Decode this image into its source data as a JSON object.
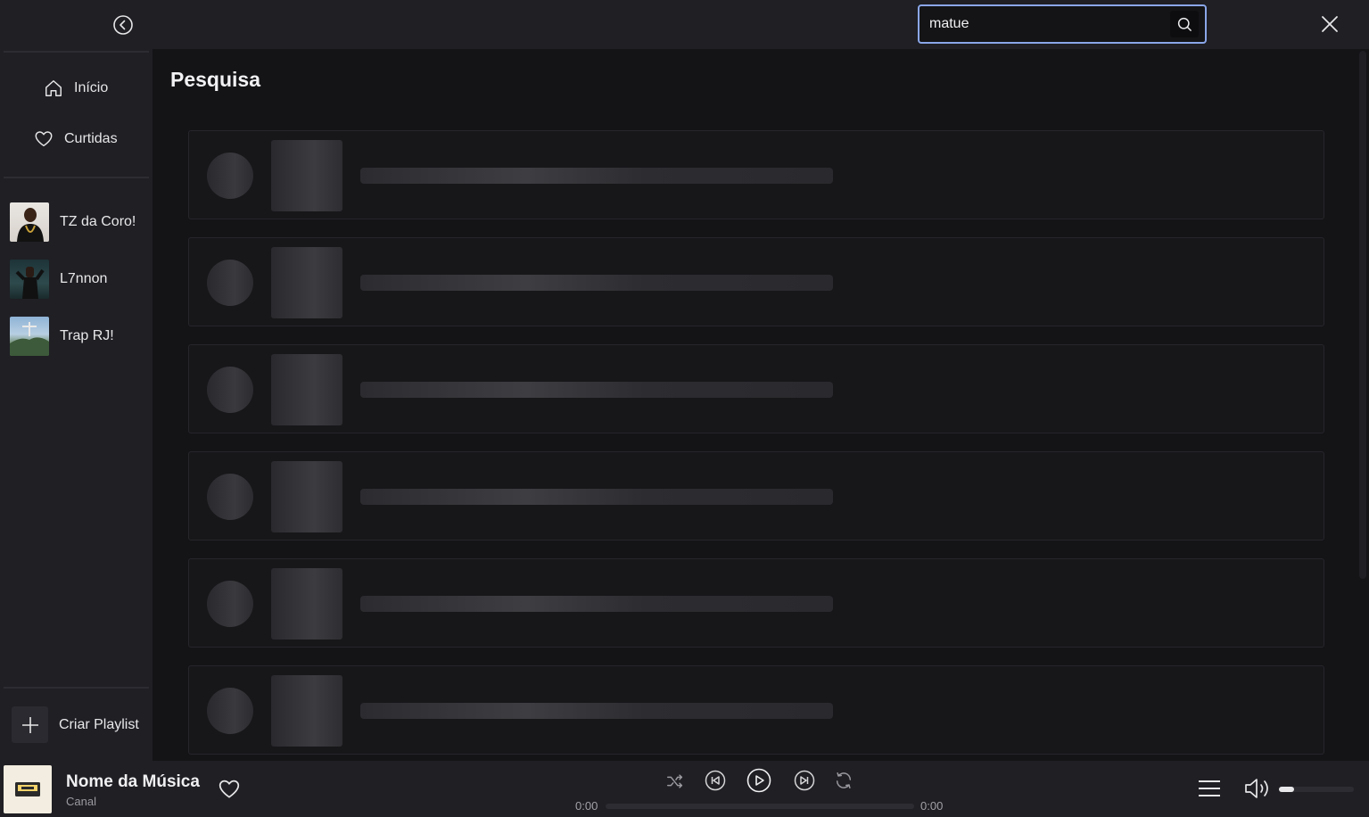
{
  "sidebar": {
    "nav": [
      {
        "label": "Início",
        "icon": "home-icon"
      },
      {
        "label": "Curtidas",
        "icon": "heart-icon"
      }
    ],
    "playlists": [
      {
        "label": "TZ da Coro!"
      },
      {
        "label": "L7nnon"
      },
      {
        "label": "Trap RJ!"
      }
    ],
    "create_label": "Criar Playlist"
  },
  "search": {
    "value": "matue"
  },
  "main": {
    "title": "Pesquisa",
    "result_count": 6
  },
  "player": {
    "title": "Nome da Música",
    "channel": "Canal",
    "time_current": "0:00",
    "time_total": "0:00",
    "progress": 0,
    "volume": 0.2
  },
  "colors": {
    "accent_border": "#8aa6e8",
    "background": "#141417",
    "panel": "#1f1f24"
  }
}
